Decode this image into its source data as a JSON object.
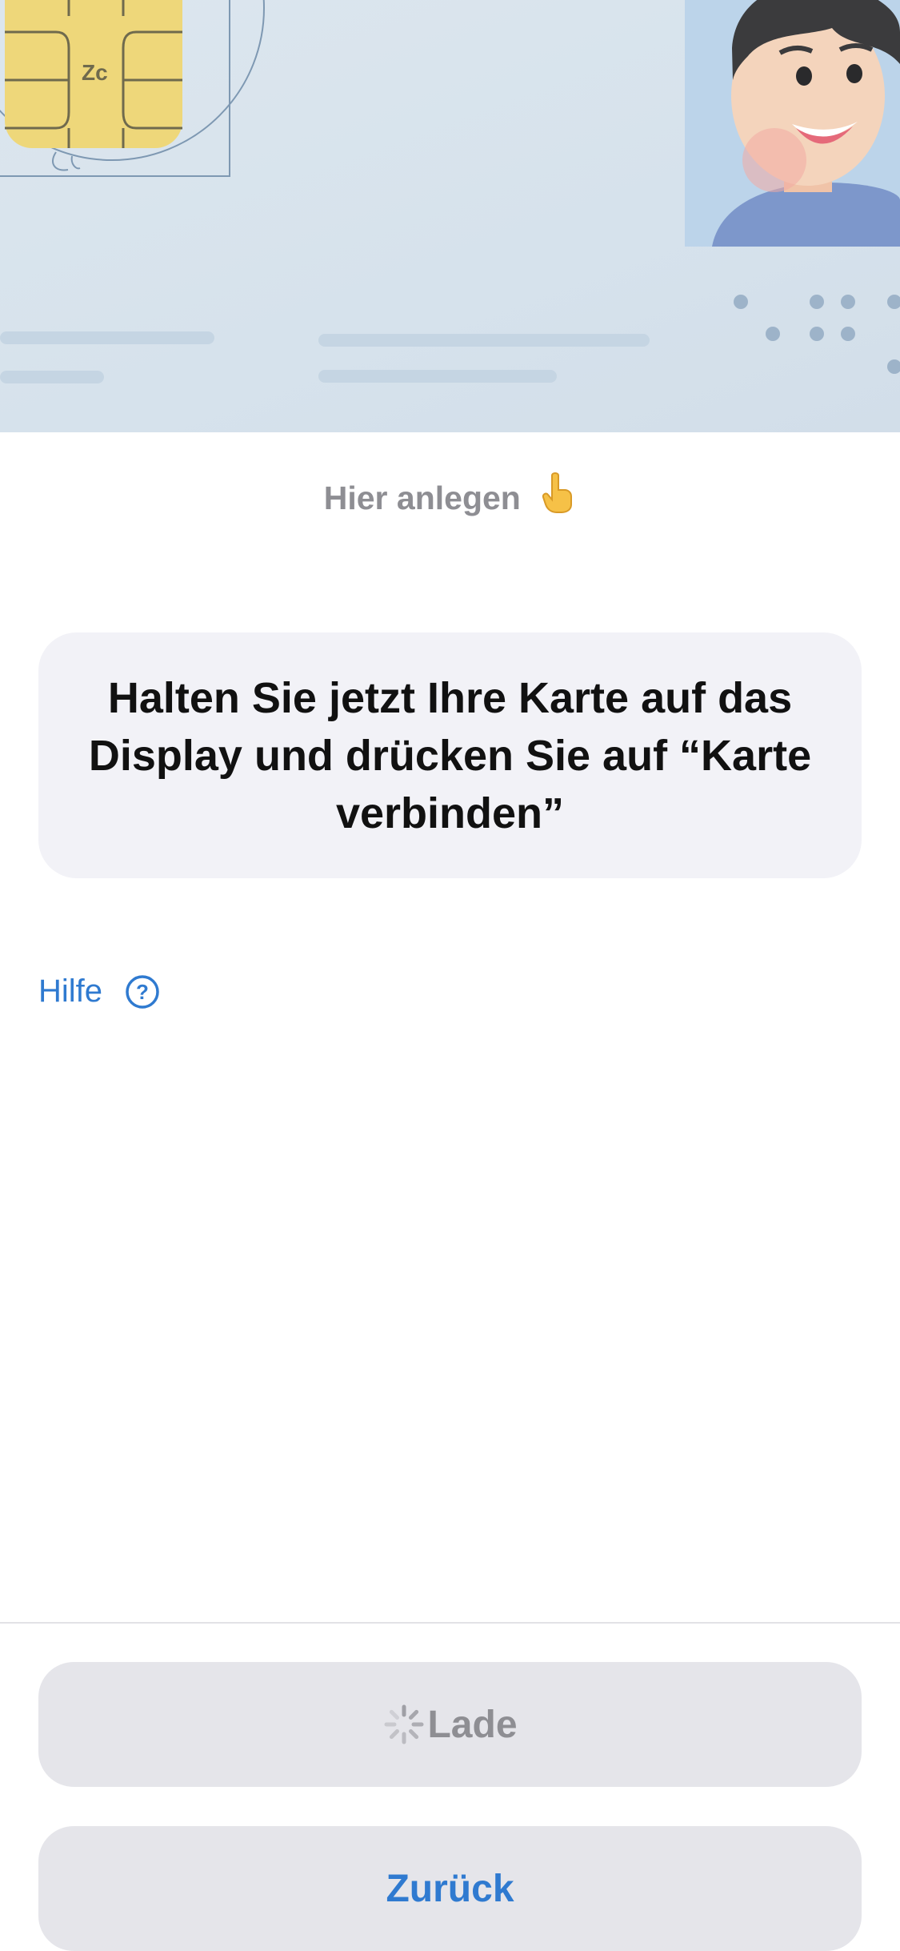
{
  "card_illustration": {
    "chip_icon": "sim-chip-icon",
    "portrait": "avatar-portrait"
  },
  "placement_hint": {
    "text": "Hier anlegen",
    "icon": "pointing-hand-icon"
  },
  "instruction": {
    "text": "Halten Sie jetzt Ihre Karte auf das Display und drücken Sie auf “Karte verbinden”"
  },
  "help": {
    "label": "Hilfe",
    "icon": "question-circle-icon"
  },
  "buttons": {
    "loading_label": "Lade",
    "loading_icon": "spinner-icon",
    "back_label": "Zurück"
  },
  "colors": {
    "accent": "#2f7ad0",
    "muted_text": "#8e8e93",
    "button_bg": "#e5e5ea",
    "box_bg": "#f2f2f7"
  }
}
